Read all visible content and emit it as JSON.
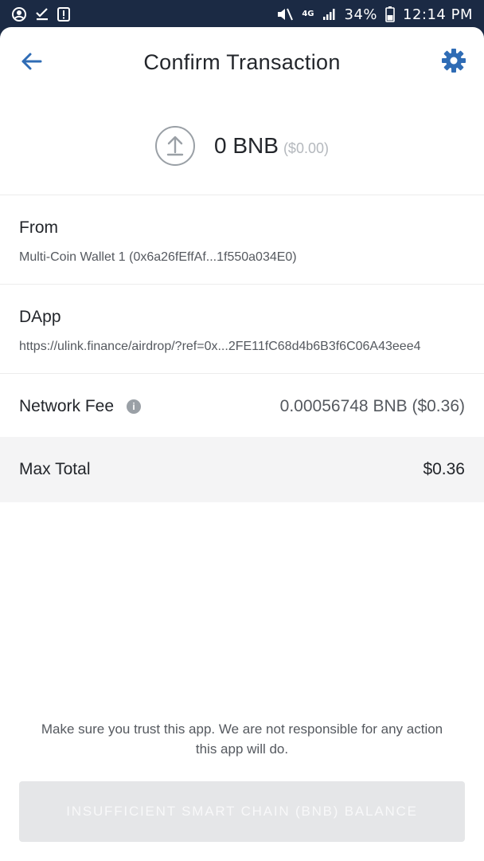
{
  "status_bar": {
    "network": "4G",
    "battery": "34%",
    "time": "12:14 PM",
    "icons": [
      "account-circle-icon",
      "download-check-icon",
      "alert-box-icon",
      "mute-icon",
      "network-4g-icon",
      "signal-icon",
      "battery-icon"
    ]
  },
  "header": {
    "title": "Confirm Transaction",
    "back_icon": "arrow-left-icon",
    "settings_icon": "gear-icon",
    "accent": "#2f6cb5"
  },
  "amount": {
    "value": "0 BNB",
    "fiat": "($0.00)",
    "icon": "upload-arrow-icon"
  },
  "from": {
    "label": "From",
    "value": "Multi-Coin Wallet 1 (0x6a26fEffAf...1f550a034E0)"
  },
  "dapp": {
    "label": "DApp",
    "value": "https://ulink.finance/airdrop/?ref=0x...2FE11fC68d4b6B3f6C06A43eee4"
  },
  "network_fee": {
    "label": "Network Fee",
    "value": "0.00056748 BNB ($0.36)",
    "icon": "info-icon"
  },
  "max_total": {
    "label": "Max Total",
    "value": "$0.36"
  },
  "disclaimer": "Make sure you trust this app. We are not responsible for any action this app will do.",
  "cta": {
    "label": "INSUFFICIENT SMART CHAIN (BNB) BALANCE",
    "disabled": true
  }
}
